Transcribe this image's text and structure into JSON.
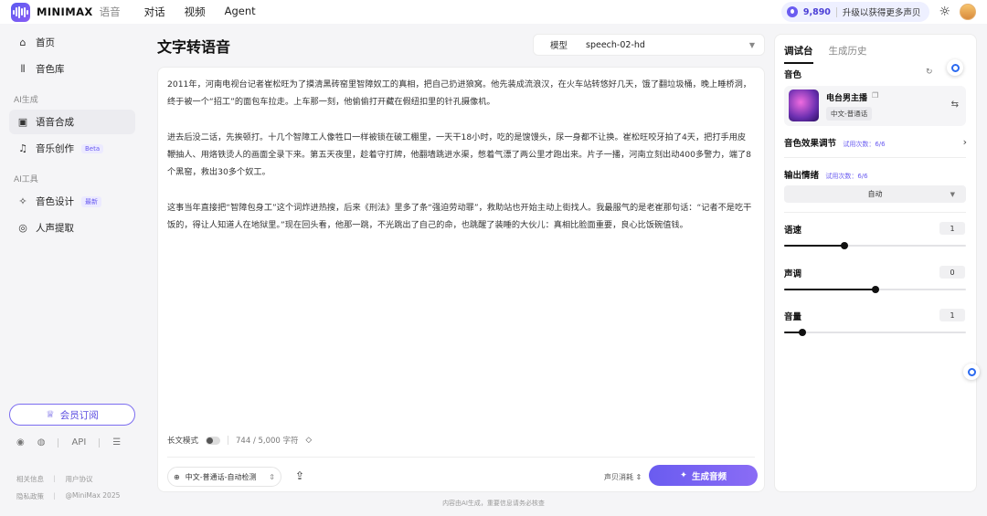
{
  "brand": {
    "name": "MINIMAX",
    "sub": "语音"
  },
  "topnav": [
    "对话",
    "视频",
    "Agent"
  ],
  "credits": {
    "amount": "9,890",
    "upgrade": "升级以获得更多声贝"
  },
  "sidebar": {
    "items": [
      {
        "label": "首页",
        "icon": "home-icon"
      },
      {
        "label": "音色库",
        "icon": "library-icon"
      }
    ],
    "ai_gen_label": "AI生成",
    "gen_items": [
      {
        "label": "语音合成",
        "icon": "tts-icon",
        "active": true
      },
      {
        "label": "音乐创作",
        "icon": "music-icon",
        "badge": "Beta"
      }
    ],
    "ai_tools_label": "AI工具",
    "tool_items": [
      {
        "label": "音色设计",
        "icon": "design-icon",
        "badge": "最新"
      },
      {
        "label": "人声提取",
        "icon": "extract-icon"
      }
    ],
    "subscribe": "会员订阅",
    "social_api": "API",
    "footer": {
      "related": "相关信息",
      "agreement": "用户协议",
      "privacy": "隐私政策",
      "copyright": "@MiniMax 2025"
    }
  },
  "main": {
    "title": "文字转语音",
    "model_label": "模型",
    "model_value": "speech-02-hd",
    "paragraphs": [
      "2011年，河南电视台记者崔松旺为了摸清黑砖窑里智障奴工的真相，把自己扔进狼窝。他先装成流浪汉，在火车站转悠好几天，饿了翻垃圾桶，晚上睡桥洞，终于被一个“招工”的面包车拉走。上车那一刻，他偷偷打开藏在假纽扣里的针孔摄像机。",
      "进去后没二话，先挨顿打。十几个智障工人像牲口一样被锁在破工棚里，一天干18小时，吃的是馊馒头，尿一身都不让换。崔松旺咬牙拍了4天，把打手用皮鞭抽人、用烙铁烫人的画面全录下来。第五天夜里，趁着守打牌，他翻墙跳进水渠，憋着气漂了两公里才跑出来。片子一播，河南立刻出动400多警力，端了8个黑窑，救出30多个奴工。",
      "这事当年直接把“智障包身工”这个词炸进热搜，后来《刑法》里多了条“强迫劳动罪”，救助站也开始主动上街找人。我最服气的是老崔那句话：“记者不是吃干饭的，得让人知道人在地狱里。”现在回头看，他那一跳，不光跳出了自己的命，也跳醒了装睡的大伙儿：真相比脸面重要，良心比饭碗值钱。"
    ],
    "long_mode": "长文模式",
    "char_count": "744 / 5,000 字符",
    "language": "中文-普通话-自动检测",
    "cost_label": "声贝消耗",
    "generate": "生成音频",
    "disclaimer": "内容由AI生成，重要信息请务必核查"
  },
  "rpanel": {
    "tabs": [
      "调试台",
      "生成历史"
    ],
    "voice_label": "音色",
    "voice_name": "电台男主播",
    "voice_tag": "中文-普通话",
    "effect_label": "音色效果调节",
    "trial_text": "试用次数：6/6",
    "emotion_label": "输出情绪",
    "emotion_value": "自动",
    "sliders": [
      {
        "label": "语速",
        "value": "1",
        "level": 0.33
      },
      {
        "label": "声调",
        "value": "0",
        "level": 0.5
      },
      {
        "label": "音量",
        "value": "1",
        "level": 0.1
      }
    ]
  }
}
